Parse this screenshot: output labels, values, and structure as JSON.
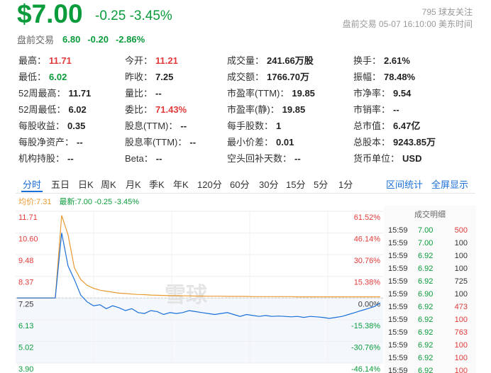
{
  "quote": {
    "price": "$7.00",
    "change": "-0.25 -3.45%",
    "followers": "795 球友关注",
    "pre_time": "盘前交易 05-07 16:10:00 美东时间"
  },
  "premarket": {
    "label": "盘前交易",
    "price": "6.80",
    "change": "-0.20",
    "pct": "-2.86%"
  },
  "stats": [
    [
      {
        "k": "最高：",
        "v": "11.71",
        "c": "red"
      },
      {
        "k": "今开：",
        "v": "11.21",
        "c": "red"
      },
      {
        "k": "成交量：",
        "v": "241.66万股",
        "c": ""
      },
      {
        "k": "换手：",
        "v": "2.61%",
        "c": ""
      }
    ],
    [
      {
        "k": "最低：",
        "v": "6.02",
        "c": "green"
      },
      {
        "k": "昨收：",
        "v": "7.25",
        "c": ""
      },
      {
        "k": "成交额：",
        "v": "1766.70万",
        "c": ""
      },
      {
        "k": "振幅：",
        "v": "78.48%",
        "c": ""
      }
    ],
    [
      {
        "k": "52周最高：",
        "v": "11.71",
        "c": ""
      },
      {
        "k": "量比：",
        "v": "--",
        "c": ""
      },
      {
        "k": "市盈率(TTM)：",
        "v": "19.85",
        "c": ""
      },
      {
        "k": "市净率：",
        "v": "9.54",
        "c": ""
      }
    ],
    [
      {
        "k": "52周最低：",
        "v": "6.02",
        "c": ""
      },
      {
        "k": "委比：",
        "v": "71.43%",
        "c": "red"
      },
      {
        "k": "市盈率(静)：",
        "v": "19.85",
        "c": ""
      },
      {
        "k": "市销率：",
        "v": "--",
        "c": ""
      }
    ],
    [
      {
        "k": "每股收益：",
        "v": "0.35",
        "c": ""
      },
      {
        "k": "股息(TTM)：",
        "v": "--",
        "c": ""
      },
      {
        "k": "每手股数：",
        "v": "1",
        "c": ""
      },
      {
        "k": "总市值：",
        "v": "6.47亿",
        "c": ""
      }
    ],
    [
      {
        "k": "每股净资产：",
        "v": "--",
        "c": ""
      },
      {
        "k": "股息率(TTM)：",
        "v": "--",
        "c": ""
      },
      {
        "k": "最小价差：",
        "v": "0.01",
        "c": ""
      },
      {
        "k": "总股本：",
        "v": "9243.85万",
        "c": ""
      }
    ],
    [
      {
        "k": "机构持股：",
        "v": "--",
        "c": ""
      },
      {
        "k": "Beta：",
        "v": "--",
        "c": ""
      },
      {
        "k": "空头回补天数：",
        "v": "--",
        "c": ""
      },
      {
        "k": "货币单位：",
        "v": "USD",
        "c": ""
      }
    ]
  ],
  "tabs": [
    "分时",
    "五日",
    "日K",
    "周K",
    "月K",
    "季K",
    "年K",
    "120分",
    "60分",
    "30分",
    "15分",
    "5分",
    "1分"
  ],
  "tab_actions": [
    "区间统计",
    "全屏显示"
  ],
  "legend": {
    "avg": "均价:7.31",
    "latest": "最新:7.00 -0.25 -3.45%"
  },
  "watermark": "雪球",
  "colors": {
    "up": "#e23a3a",
    "down": "#0a9b3b",
    "price_line": "#1a6fd8",
    "avg_line": "#e89a30",
    "accent": "#1a6fd8"
  },
  "chart_data": {
    "type": "line",
    "prev_close": 7.25,
    "ylim": [
      3.9,
      11.71
    ],
    "y_ticks_left": [
      "11.71",
      "10.60",
      "9.48",
      "8.37",
      "7.25",
      "6.13",
      "5.02",
      "3.90"
    ],
    "y_ticks_right": [
      "61.52%",
      "46.14%",
      "30.76%",
      "15.38%",
      "0.00%",
      "-15.38%",
      "-30.76%",
      "-46.14%"
    ],
    "series": [
      {
        "name": "最新",
        "values": [
          7.25,
          7.25,
          7.25,
          7.25,
          7.25,
          7.25,
          7.25,
          10.6,
          8.9,
          8.2,
          7.4,
          7.05,
          6.85,
          6.9,
          6.7,
          6.85,
          6.75,
          6.6,
          6.7,
          6.5,
          6.45,
          6.6,
          6.55,
          6.4,
          6.5,
          6.45,
          6.5,
          6.6,
          6.55,
          6.5,
          6.45,
          6.4,
          6.45,
          6.5,
          6.4,
          6.3,
          6.4,
          6.35,
          6.3,
          6.35,
          6.3,
          6.32,
          6.3,
          6.28,
          6.3,
          6.25,
          6.3,
          6.28,
          6.25,
          6.2,
          6.25,
          6.3,
          6.4,
          6.5,
          6.6,
          6.7,
          6.8,
          7.0
        ]
      },
      {
        "name": "均价",
        "values": [
          7.25,
          7.25,
          7.25,
          7.25,
          7.25,
          7.25,
          7.25,
          11.5,
          10.5,
          8.8,
          8.2,
          7.9,
          7.75,
          7.65,
          7.6,
          7.55,
          7.5,
          7.48,
          7.45,
          7.43,
          7.42,
          7.4,
          7.39,
          7.38,
          7.37,
          7.37,
          7.36,
          7.36,
          7.35,
          7.35,
          7.34,
          7.34,
          7.34,
          7.33,
          7.33,
          7.33,
          7.33,
          7.32,
          7.32,
          7.32,
          7.32,
          7.32,
          7.32,
          7.32,
          7.31,
          7.31,
          7.31,
          7.31,
          7.31,
          7.31,
          7.31,
          7.31,
          7.31,
          7.31,
          7.31,
          7.31,
          7.31,
          7.31
        ]
      }
    ]
  },
  "trades": {
    "title": "成交明细",
    "rows": [
      {
        "time": "15:59",
        "price": "7.00",
        "vol": "500",
        "pc": "green",
        "vc": "red"
      },
      {
        "time": "15:59",
        "price": "7.00",
        "vol": "100",
        "pc": "green",
        "vc": "dark"
      },
      {
        "time": "15:59",
        "price": "6.92",
        "vol": "100",
        "pc": "green",
        "vc": "dark"
      },
      {
        "time": "15:59",
        "price": "6.92",
        "vol": "100",
        "pc": "green",
        "vc": "dark"
      },
      {
        "time": "15:59",
        "price": "6.92",
        "vol": "725",
        "pc": "green",
        "vc": "dark"
      },
      {
        "time": "15:59",
        "price": "6.90",
        "vol": "100",
        "pc": "green",
        "vc": "dark"
      },
      {
        "time": "15:59",
        "price": "6.92",
        "vol": "473",
        "pc": "green",
        "vc": "red"
      },
      {
        "time": "15:59",
        "price": "6.92",
        "vol": "100",
        "pc": "green",
        "vc": "red"
      },
      {
        "time": "15:59",
        "price": "6.92",
        "vol": "763",
        "pc": "green",
        "vc": "red"
      },
      {
        "time": "15:59",
        "price": "6.92",
        "vol": "100",
        "pc": "green",
        "vc": "red"
      },
      {
        "time": "15:59",
        "price": "6.92",
        "vol": "100",
        "pc": "green",
        "vc": "red"
      },
      {
        "time": "15:59",
        "price": "6.92",
        "vol": "100",
        "pc": "green",
        "vc": "red"
      }
    ]
  }
}
